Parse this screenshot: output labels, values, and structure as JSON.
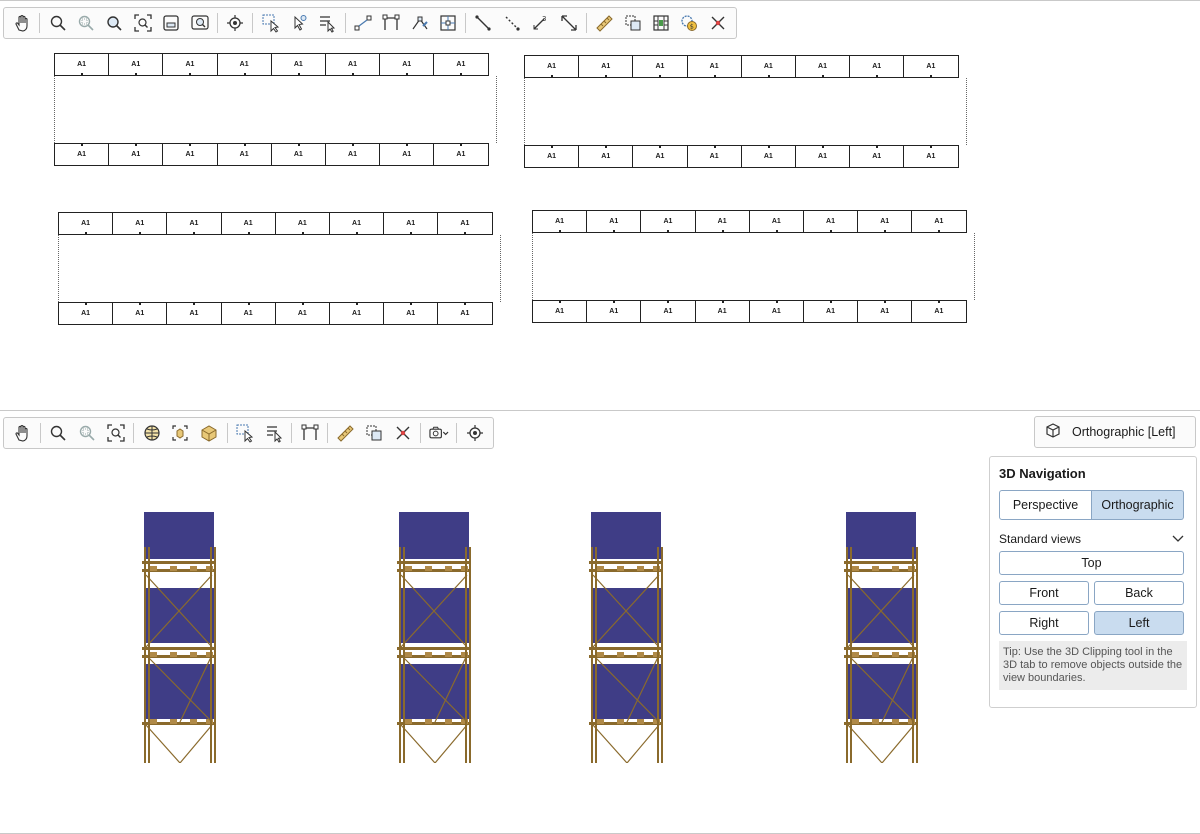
{
  "top_toolbar": {
    "groups": [
      [
        "hand-pan-icon"
      ],
      [
        "zoom-icon",
        "zoom-area-icon",
        "zoom-all-icon",
        "zoom-extents-icon",
        "zoom-window-icon",
        "zoom-selection-icon"
      ],
      [
        "focus-target-icon"
      ],
      [
        "select-box-icon",
        "select-cursor-icon",
        "select-list-icon"
      ],
      [
        "node-link-icon",
        "dimension-frame-icon",
        "node-edit-icon",
        "grid-node-icon"
      ],
      [
        "line-draw-icon",
        "dashed-line-icon",
        "measure-3-icon",
        "arrows-resize-icon"
      ],
      [
        "ruler-icon",
        "copy-select-icon",
        "filmstrip-icon",
        "cost-settings-icon",
        "delete-cross-icon"
      ]
    ]
  },
  "plan": {
    "cell_label": "A1",
    "racks": [
      {
        "name": "rack-plan-1"
      },
      {
        "name": "rack-plan-2"
      },
      {
        "name": "rack-plan-3"
      },
      {
        "name": "rack-plan-4"
      }
    ]
  },
  "bottom_toolbar": {
    "groups": [
      [
        "hand-pan-icon"
      ],
      [
        "zoom-icon",
        "zoom-area-icon",
        "zoom-extents-icon"
      ],
      [
        "globe-icon",
        "view-box-icon",
        "model-box-icon"
      ],
      [
        "select-box-icon",
        "select-list-icon"
      ],
      [
        "dimension-frame-icon"
      ],
      [
        "ruler-icon",
        "copy-select-icon",
        "delete-cross-icon"
      ],
      [
        "camera-dropdown-icon"
      ],
      [
        "focus-target-icon"
      ]
    ]
  },
  "view_button": {
    "label": "Orthographic [Left]"
  },
  "navigation": {
    "title": "3D Navigation",
    "projection": {
      "perspective": "Perspective",
      "orthographic": "Orthographic",
      "selected": "Orthographic"
    },
    "standard_views_label": "Standard views",
    "views": {
      "top": "Top",
      "front": "Front",
      "back": "Back",
      "right": "Right",
      "left": "Left",
      "selected": "Left"
    },
    "tip": "Tip: Use the 3D Clipping tool in the 3D tab to remove objects outside the view boundaries."
  },
  "colors": {
    "pallet_load": "#3f3d86",
    "frame": "#8a6a2c",
    "accent": "#c9dcef"
  }
}
